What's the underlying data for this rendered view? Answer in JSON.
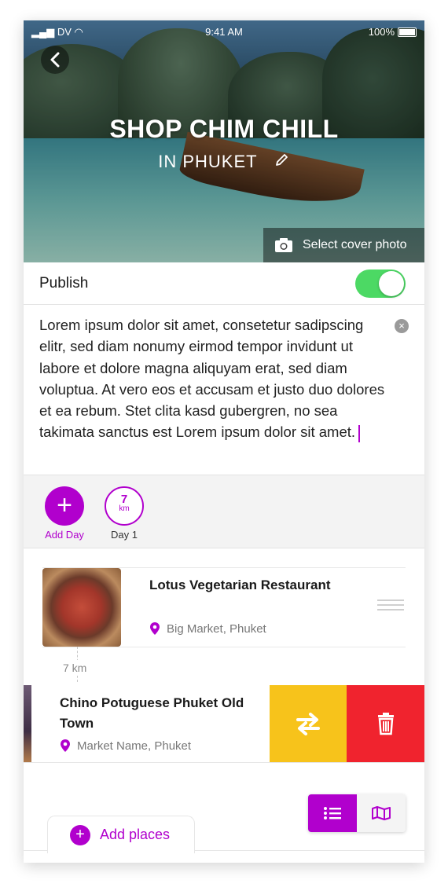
{
  "status_bar": {
    "carrier": "DV",
    "time": "9:41 AM",
    "battery": "100%"
  },
  "hero": {
    "title": "SHOP CHIM CHILL",
    "subtitle": "IN PHUKET",
    "cover_button_label": "Select cover photo"
  },
  "publish": {
    "label": "Publish",
    "enabled": true
  },
  "description": {
    "text": "Lorem ipsum dolor sit amet, consetetur sadipscing elitr, sed diam nonumy eirmod tempor invidunt ut labore et dolore magna aliquyam erat, sed diam voluptua. At vero eos et accusam et justo duo dolores et ea rebum. Stet clita kasd gubergren, no sea takimata sanctus est Lorem ipsum dolor sit amet."
  },
  "days": {
    "add_label": "Add Day",
    "day1_distance": "7",
    "day1_unit": "km",
    "day1_label": "Day 1"
  },
  "places": [
    {
      "name": "Lotus Vegetarian Restaurant",
      "location": "Big Market, Phuket"
    },
    {
      "name": "Chino Potuguese Phuket Old Town",
      "location": "Market Name, Phuket"
    }
  ],
  "distance_between": "7 km",
  "add_places_label": "Add places",
  "colors": {
    "accent": "#b100cd",
    "toggle_on": "#4cd964",
    "swap": "#f7c31b",
    "delete": "#f0232e"
  }
}
